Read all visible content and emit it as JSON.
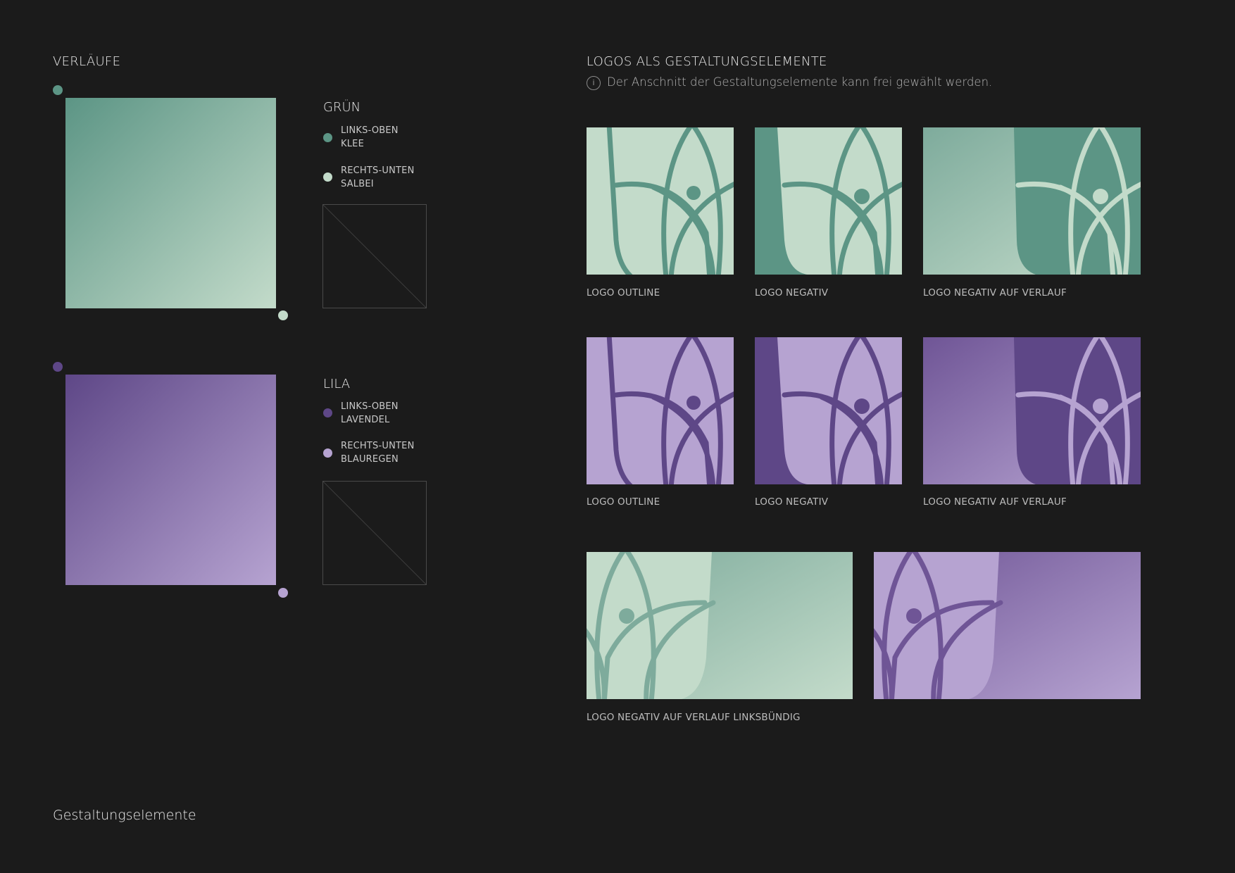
{
  "left": {
    "title": "VERLÄUFE",
    "gradients": [
      {
        "name": "GRÜN",
        "start": {
          "position": "LINKS-OBEN",
          "color_name": "KLEE",
          "hex": "#5c9585"
        },
        "end": {
          "position": "RECHTS-UNTEN",
          "color_name": "SALBEI",
          "hex": "#c3dbca"
        }
      },
      {
        "name": "LILA",
        "start": {
          "position": "LINKS-OBEN",
          "color_name": "LAVENDEL",
          "hex": "#5e4787"
        },
        "end": {
          "position": "RECHTS-UNTEN",
          "color_name": "BLAUREGEN",
          "hex": "#b6a3d1"
        }
      }
    ]
  },
  "right": {
    "title": "LOGOS ALS GESTALTUNGSELEMENTE",
    "info_text": "Der Anschnitt der Gestaltungselemente kann frei gewählt werden.",
    "info_icon": "i",
    "rows": [
      {
        "labels": [
          "LOGO OUTLINE",
          "LOGO NEGATIV",
          "LOGO NEGATIV AUF VERLAUF"
        ]
      },
      {
        "labels": [
          "LOGO OUTLINE",
          "LOGO NEGATIV",
          "LOGO NEGATIV AUF VERLAUF"
        ]
      }
    ],
    "wide_label": "LOGO NEGATIV AUF VERLAUF LINKSBÜNDIG"
  },
  "footer": {
    "title": "Gestaltungselemente"
  },
  "colors": {
    "background": "#1b1b1b",
    "green_dark": "#5c9585",
    "green_light": "#c3dbca",
    "purple_dark": "#5e4787",
    "purple_light": "#b6a3d1"
  }
}
